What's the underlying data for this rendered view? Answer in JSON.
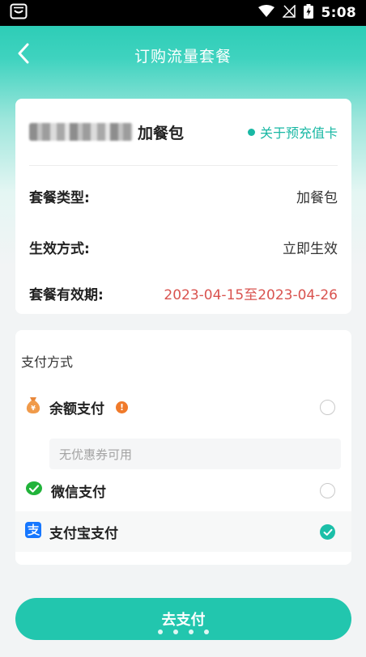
{
  "status_bar": {
    "time": "5:08",
    "icons": [
      "app-notification-icon",
      "wifi-icon",
      "signal-icon",
      "battery-icon"
    ]
  },
  "navbar": {
    "title": "订购流量套餐",
    "back_icon": "back-arrow-icon"
  },
  "package": {
    "name_suffix": "加餐包",
    "about_link": "关于预充值卡",
    "rows": [
      {
        "key": "套餐类型:",
        "value": "加餐包"
      },
      {
        "key": "生效方式:",
        "value": "立即生效"
      },
      {
        "key": "套餐有效期:",
        "value": "2023-04-15至2023-04-26"
      }
    ]
  },
  "payment": {
    "title": "支付方式",
    "coupon_placeholder": "无优惠券可用",
    "methods": [
      {
        "label": "余额支付",
        "icon": "money-bag-icon",
        "selected": false
      },
      {
        "label": "微信支付",
        "icon": "wechat-icon",
        "selected": false
      },
      {
        "label": "支付宝支付",
        "icon": "alipay-icon",
        "selected": true
      }
    ]
  },
  "submit": {
    "label": "去支付"
  },
  "colors": {
    "accent": "#22c6ae",
    "link": "#19b8a4",
    "validity_date": "#d9534f",
    "warning": "#f07a2a"
  }
}
